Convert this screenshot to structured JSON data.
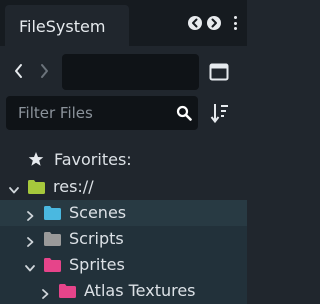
{
  "dock": {
    "tab_label": "FileSystem",
    "tab_prev_icon": "chevron-left-circle-icon",
    "tab_next_icon": "chevron-right-circle-icon",
    "menu_icon": "vertical-dots-icon"
  },
  "navigation": {
    "back_icon": "chevron-left-icon",
    "forward_icon": "chevron-right-icon",
    "path_value": "",
    "view_toggle_icon": "split-view-icon"
  },
  "filter": {
    "placeholder": "Filter Files",
    "value": "",
    "search_icon": "search-icon",
    "sort_icon": "sort-icon"
  },
  "tree": {
    "favorites_label": "Favorites:",
    "root_label": "res://",
    "items": [
      {
        "label": "Scenes",
        "folder_color": "#4ab8e0"
      },
      {
        "label": "Scripts",
        "folder_color": "#9a9a9a"
      },
      {
        "label": "Sprites",
        "folder_color": "#e6448a"
      },
      {
        "label": "Atlas Textures",
        "folder_color": "#e6448a"
      }
    ],
    "root_folder_color": "#a6c83c"
  },
  "colors": {
    "panel_bg": "#20262d",
    "tabbar_bg": "#161b20",
    "field_bg": "#0f1317",
    "selected_row": "#283a43"
  }
}
